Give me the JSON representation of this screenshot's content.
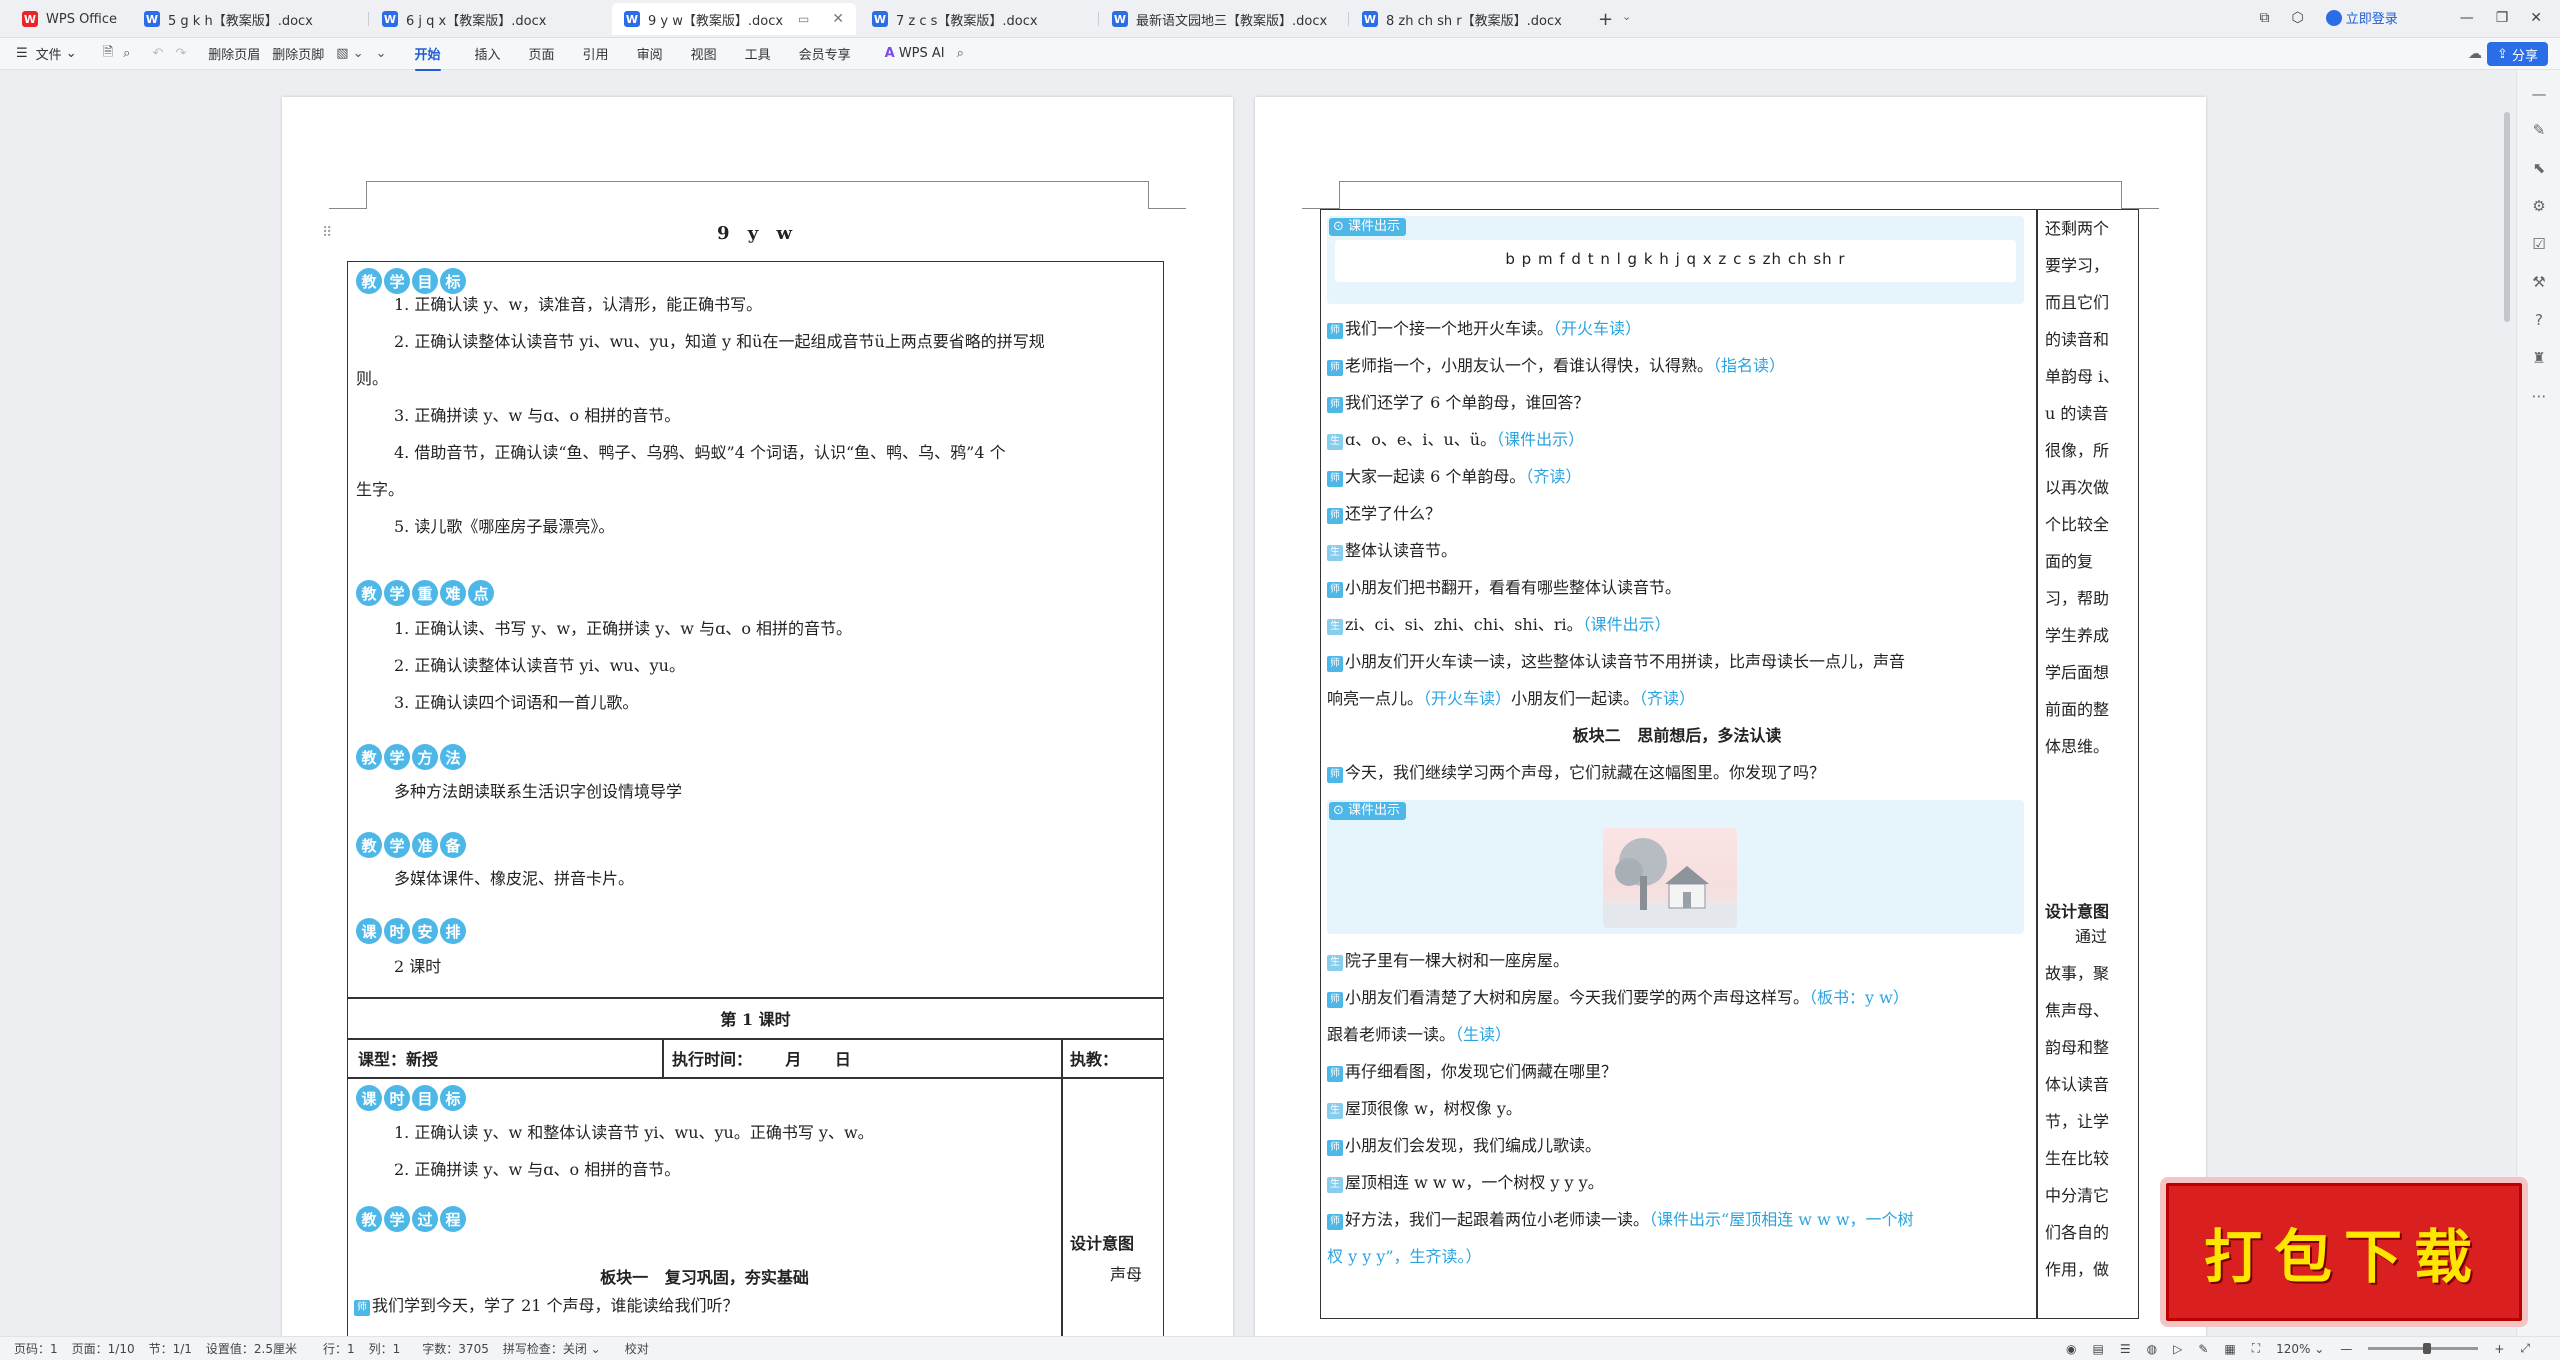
{
  "app": {
    "name": "WPS Office"
  },
  "tabs": [
    {
      "label": "WPS Office"
    },
    {
      "label": "5 g k h【教案版】.docx"
    },
    {
      "label": "6 j q x【教案版】.docx"
    },
    {
      "label": "9 y w【教案版】.docx"
    },
    {
      "label": "7 z c s【教案版】.docx"
    },
    {
      "label": "最新语文园地三【教案版】.docx"
    },
    {
      "label": "8 zh ch sh r【教案版】.docx"
    }
  ],
  "window": {
    "login": "立即登录",
    "share": "分享"
  },
  "ribbon": {
    "file": "文件",
    "delete_header": "删除页眉",
    "delete_footer": "删除页脚",
    "tabs": [
      "开始",
      "插入",
      "页面",
      "引用",
      "审阅",
      "视图",
      "工具",
      "会员专享"
    ],
    "ai": "WPS AI"
  },
  "page1": {
    "title": "9 y w",
    "sec_goals": [
      "教",
      "学",
      "目",
      "标"
    ],
    "goals": [
      "1. 正确认读 y、w，读准音，认清形，能正确书写。",
      "2. 正确认读整体认读音节 yi、wu、yu，知道 y 和ü在一起组成音节ü上两点要省略的拼写规",
      "则。",
      "3. 正确拼读 y、w 与ɑ、o 相拼的音节。",
      "4. 借助音节，正确认读“鱼、鸭子、乌鸦、蚂蚁”4 个词语，认识“鱼、鸭、乌、鸦”4 个",
      "生字。",
      "5. 读儿歌《哪座房子最漂亮》。"
    ],
    "sec_key": [
      "教",
      "学",
      "重",
      "难",
      "点"
    ],
    "key": [
      "1. 正确认读、书写 y、w，正确拼读 y、w 与ɑ、o 相拼的音节。",
      "2. 正确认读整体认读音节 yi、wu、yu。",
      "3. 正确认读四个词语和一首儿歌。"
    ],
    "sec_method": [
      "教",
      "学",
      "方",
      "法"
    ],
    "method": "多种方法朗读联系生活识字创设情境导学",
    "sec_prep": [
      "教",
      "学",
      "准",
      "备"
    ],
    "prep": "多媒体课件、橡皮泥、拼音卡片。",
    "sec_time": [
      "课",
      "时",
      "安",
      "排"
    ],
    "time": "2 课时",
    "lesson1": "第 1 课时",
    "course_type": "课型：新授",
    "exec_time": "执行时间：      月      日",
    "teacher": "执教：",
    "sec_lgoals": [
      "课",
      "时",
      "目",
      "标"
    ],
    "lgoals": [
      "1. 正确认读 y、w 和整体认读音节 yi、wu、yu。正确书写 y、w。",
      "2. 正确拼读 y、w 与ɑ、o 相拼的音节。"
    ],
    "sec_process": [
      "教",
      "学",
      "过",
      "程"
    ],
    "block1": "板块一   复习巩固，夯实基础",
    "q1": "我们学到今天，学了 21 个声母，谁能读给我们听？",
    "design_intent": "设计意图",
    "design_text": "声母"
  },
  "page2": {
    "kj_label": "课件出示",
    "pinyin": "b   p   m   f   d   t   n   l   g   k   h   j   q   x   z   c   s   zh   ch   sh   r",
    "lines1": [
      {
        "tag": "师",
        "text": "我们一个接一个地开火车读。",
        "note": "（开火车读）"
      },
      {
        "tag": "师",
        "text": "老师指一个，小朋友认一个，看谁认得快，认得熟。",
        "note": "（指名读）"
      },
      {
        "tag": "师",
        "text": "我们还学了 6 个单韵母，谁回答？",
        "note": ""
      },
      {
        "tag": "生",
        "text": "ɑ、o、e、i、u、ü。",
        "note": "（课件出示）"
      },
      {
        "tag": "师",
        "text": "大家一起读 6 个单韵母。",
        "note": "（齐读）"
      },
      {
        "tag": "师",
        "text": "还学了什么？",
        "note": ""
      },
      {
        "tag": "生",
        "text": "整体认读音节。",
        "note": ""
      },
      {
        "tag": "师",
        "text": "小朋友们把书翻开，看看有哪些整体认读音节。",
        "note": ""
      },
      {
        "tag": "生",
        "text": "zi、ci、si、zhi、chi、shi、ri。",
        "note": "（课件出示）"
      },
      {
        "tag": "师",
        "text": "小朋友们开火车读一读，这些整体认读音节不用拼读，比声母读长一点儿，声音",
        "note": ""
      }
    ],
    "line_cont_a": "响亮一点儿。",
    "line_cont_b": "（开火车读）",
    "line_cont_c": "小朋友们一起读。",
    "line_cont_d": "（齐读）",
    "block2": "板块二   思前想后，多法认读",
    "q2": "今天，我们继续学习两个声母，它们就藏在这幅图里。你发现了吗？",
    "lines2": [
      {
        "tag": "生",
        "text": "院子里有一棵大树和一座房屋。",
        "note": ""
      },
      {
        "tag": "师",
        "text": "小朋友们看清楚了大树和房屋。今天我们要学的两个声母这样写。",
        "note": "（板书：y w）"
      }
    ],
    "follow": "跟着老师读一读。",
    "follow_note": "（生读）",
    "lines3": [
      {
        "tag": "师",
        "text": "再仔细看图，你发现它们俩藏在哪里？",
        "note": ""
      },
      {
        "tag": "生",
        "text": "屋顶很像 w，树杈像 y。",
        "note": ""
      },
      {
        "tag": "师",
        "text": "小朋友们会发现，我们编成儿歌读。",
        "note": ""
      },
      {
        "tag": "生",
        "text": "屋顶相连 w w w，一个树杈 y y y。",
        "note": ""
      },
      {
        "tag": "师",
        "text": "好方法，我们一起跟着两位小老师读一读。",
        "note": "（课件出示“屋顶相连 w w w，一个树"
      }
    ],
    "last_cont": "杈 y y y”，生齐读。）",
    "side_lines": [
      "还剩两个",
      "要学习，",
      "而且它们",
      "的读音和",
      "单韵母 i、",
      "u 的读音",
      "很像，所",
      "以再次做",
      "个比较全",
      "面的复",
      "习，帮助",
      "学生养成",
      "学后面想",
      "前面的整",
      "体思维。"
    ],
    "design_intent": "设计意图",
    "side_lines2": [
      "通过",
      "故事，聚",
      "焦声母、",
      "韵母和整",
      "体认读音",
      "节，让学",
      "生在比较",
      "中分清它",
      "们各自的",
      "作用，做"
    ]
  },
  "statusbar": {
    "page": "页码：1",
    "pages": "页面：1/10",
    "section": "节：1/1",
    "position": "设置值：2.5厘米",
    "line": "行：1",
    "col": "列：1",
    "words": "字数：3705",
    "spell": "拼写检查：关闭",
    "proof": "校对",
    "zoom": "120%"
  },
  "banner": {
    "text": "打包下载"
  }
}
